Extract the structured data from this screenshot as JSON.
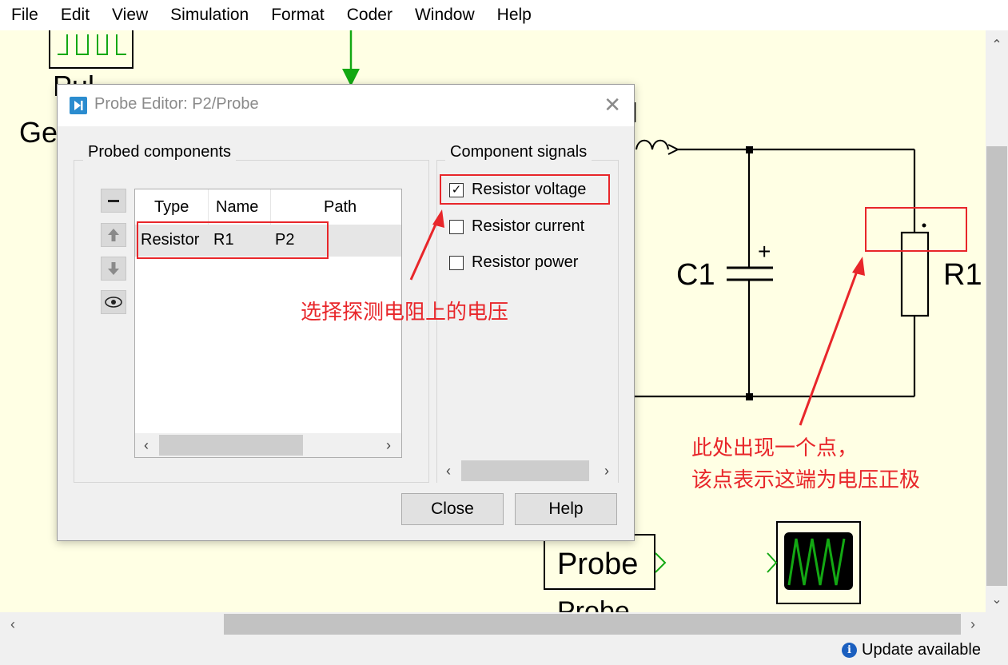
{
  "menu": [
    "File",
    "Edit",
    "View",
    "Simulation",
    "Format",
    "Coder",
    "Window",
    "Help"
  ],
  "canvas": {
    "labels": {
      "pulse_partial": "Pul",
      "gen_partial": "Ge",
      "c1": "C1",
      "c1_plus": "+",
      "r1": "R1",
      "probe_block": "Probe",
      "probe_caption": "Probe"
    }
  },
  "dialog": {
    "title": "Probe Editor: P2/Probe",
    "probed_group": "Probed components",
    "signals_group": "Component signals",
    "table": {
      "columns": [
        "Type",
        "Name",
        "Path"
      ],
      "rows": [
        {
          "type": "Resistor",
          "name": "R1",
          "path": "P2"
        }
      ]
    },
    "signals": [
      {
        "label": "Resistor voltage",
        "checked": true
      },
      {
        "label": "Resistor current",
        "checked": false
      },
      {
        "label": "Resistor power",
        "checked": false
      }
    ],
    "buttons": {
      "close": "Close",
      "help": "Help"
    }
  },
  "annotations": {
    "voltage_note": "选择探测电阻上的电压",
    "dot_note_line1": "此处出现一个点，",
    "dot_note_line2": "该点表示这端为电压正极",
    "color": "#e8262a"
  },
  "status": {
    "update": "Update available"
  },
  "colors": {
    "canvas_bg": "#ffffe4",
    "wire": "#000000",
    "signal_green": "#13a813",
    "annotation_red": "#e8262a",
    "title_icon": "#2b8ccf"
  }
}
